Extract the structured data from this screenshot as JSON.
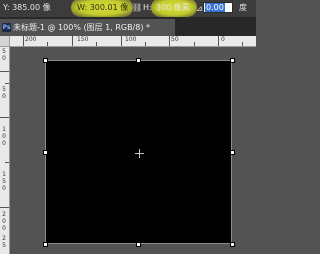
{
  "options_bar": {
    "y_label": "Y:",
    "y_value": "385.00 像",
    "w_label": "W:",
    "w_value": "300.01 像",
    "h_label": "H:",
    "h_value": "300 像素",
    "angle_value": "0.00",
    "angle_unit": "度",
    "highlight_color": "#d2d83a"
  },
  "document_tab": {
    "app_icon": "Ps",
    "title": "未标题-1 @ 100% (图层 1, RGB/8) *"
  },
  "ruler": {
    "top_labels": [
      "200",
      "150",
      "100",
      "50",
      "0"
    ],
    "left_labels": [
      "5",
      "0",
      "5",
      "0",
      "1",
      "0",
      "0",
      "1",
      "5",
      "0",
      "2",
      "0",
      "0",
      "2",
      "5",
      "0",
      "3",
      "0",
      "0"
    ]
  },
  "canvas": {
    "shape_fill": "#000000"
  }
}
